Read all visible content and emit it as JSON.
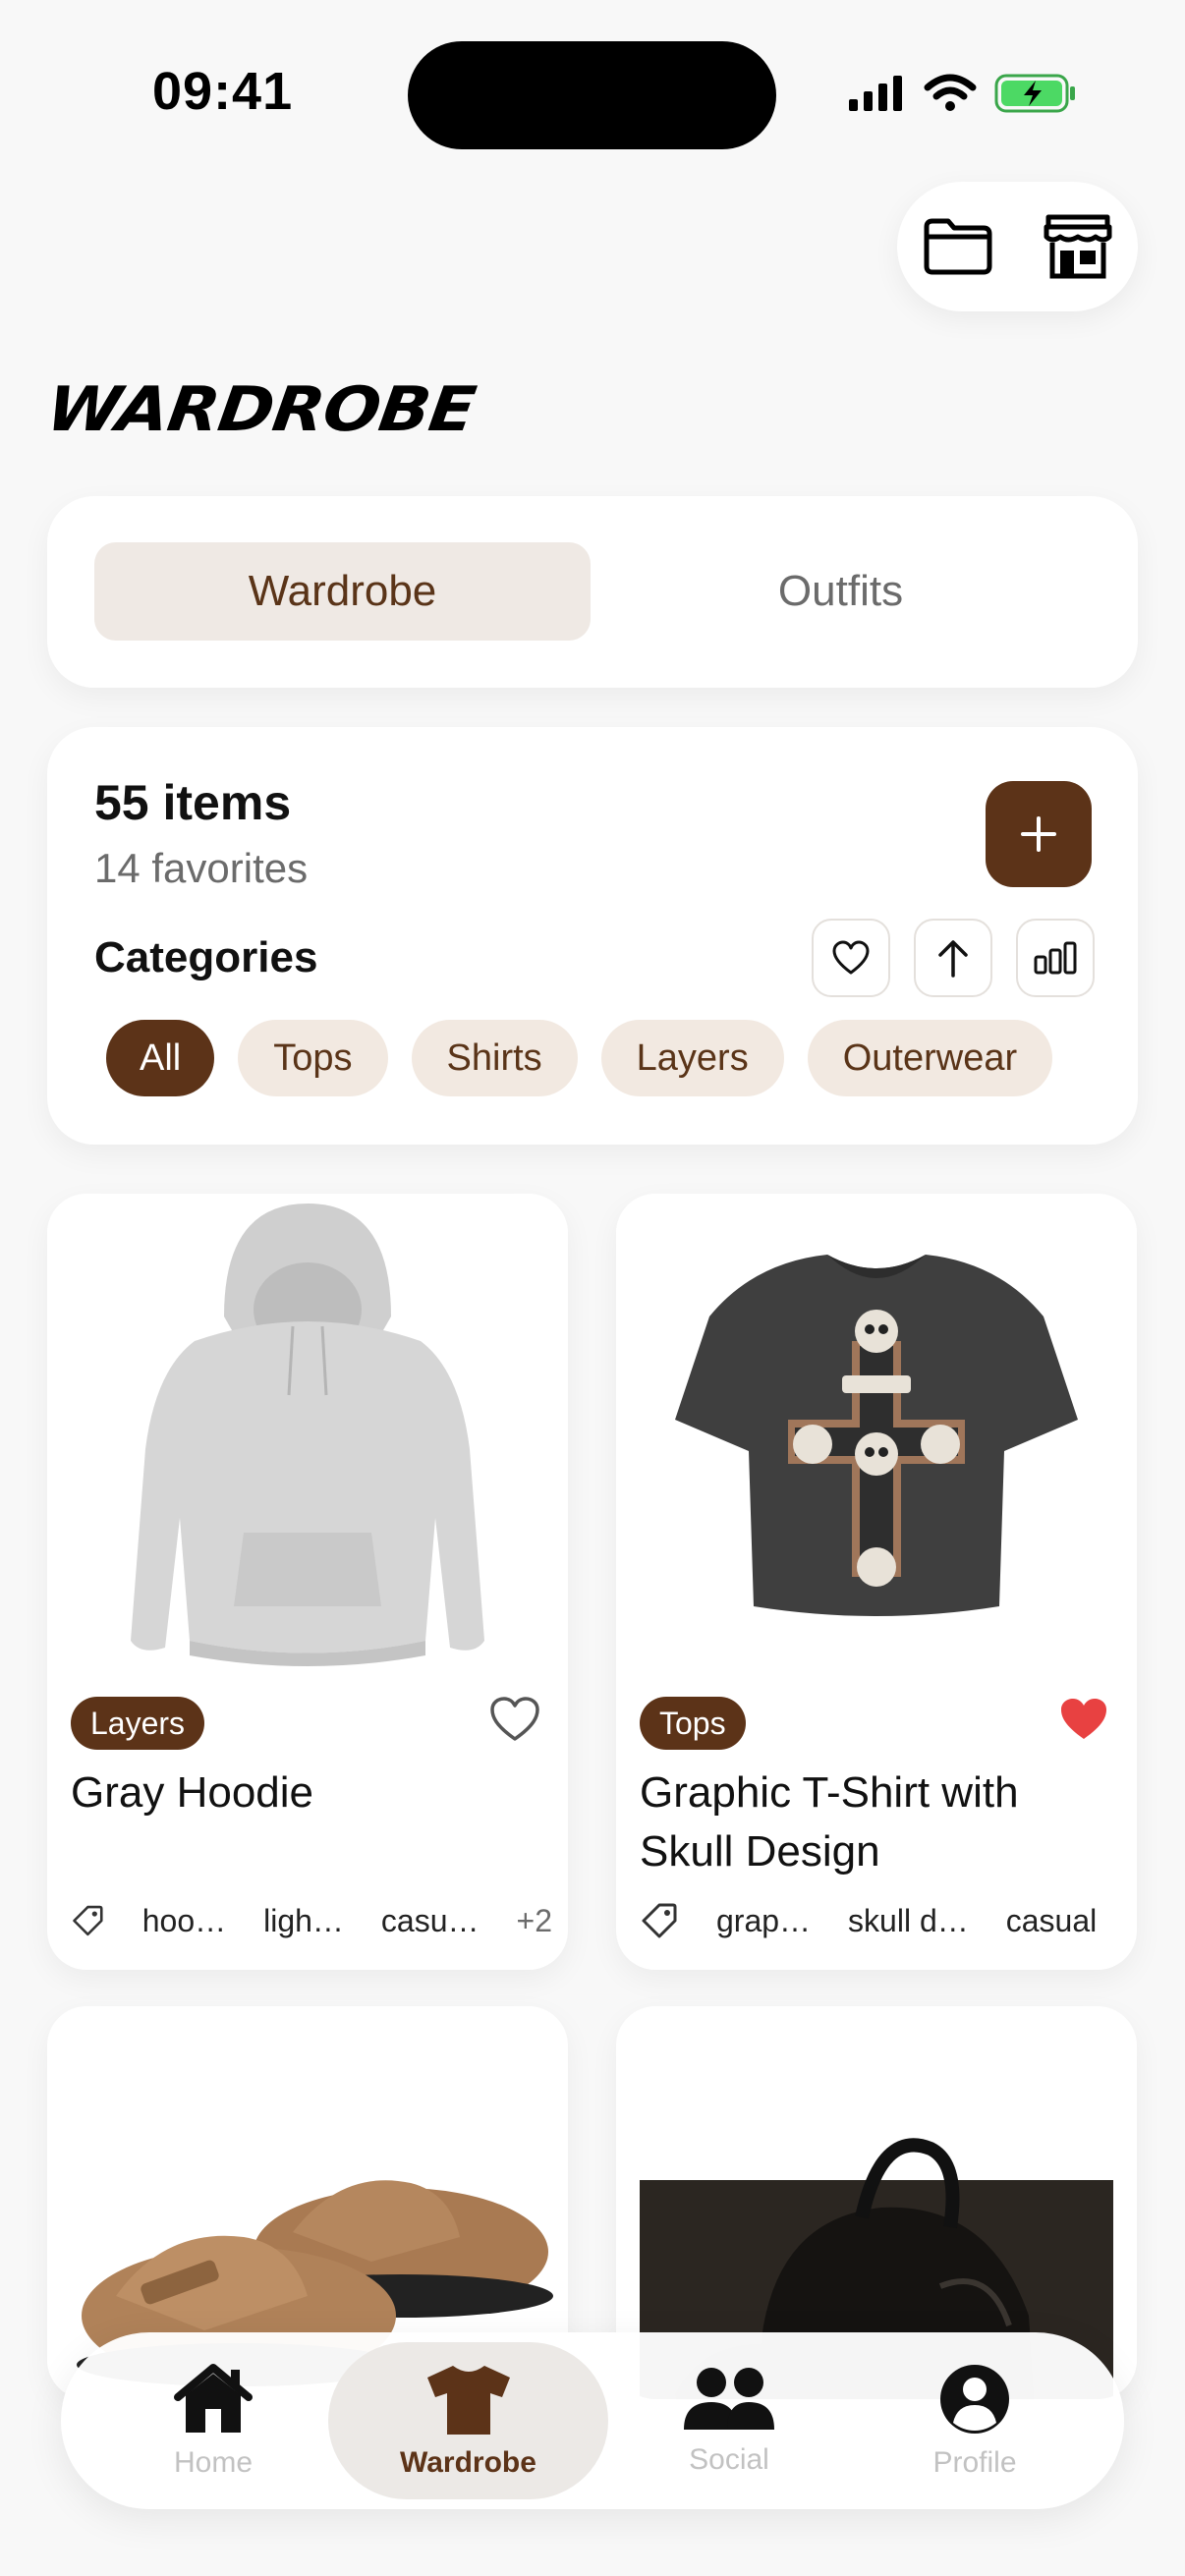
{
  "status": {
    "time": "09:41"
  },
  "header": {
    "title": "WARDROBE"
  },
  "segments": {
    "wardrobe": "Wardrobe",
    "outfits": "Outfits"
  },
  "summary": {
    "items": "55 items",
    "favorites": "14 favorites",
    "categories_label": "Categories",
    "chips": [
      "All",
      "Tops",
      "Shirts",
      "Layers",
      "Outerwear"
    ]
  },
  "items": [
    {
      "category": "Layers",
      "name": "Gray Hoodie",
      "favorite": false,
      "tags": [
        "hoo…",
        "ligh…",
        "casu…"
      ],
      "more": "+2"
    },
    {
      "category": "Tops",
      "name": "Graphic T-Shirt with Skull Design",
      "favorite": true,
      "tags": [
        "grap…",
        "skull d…",
        "casual"
      ]
    }
  ],
  "tabbar": {
    "home": "Home",
    "wardrobe": "Wardrobe",
    "social": "Social",
    "profile": "Profile"
  },
  "colors": {
    "accent": "#5c3318",
    "chip_bg": "#f2e9e1",
    "favorite": "#e84141"
  }
}
